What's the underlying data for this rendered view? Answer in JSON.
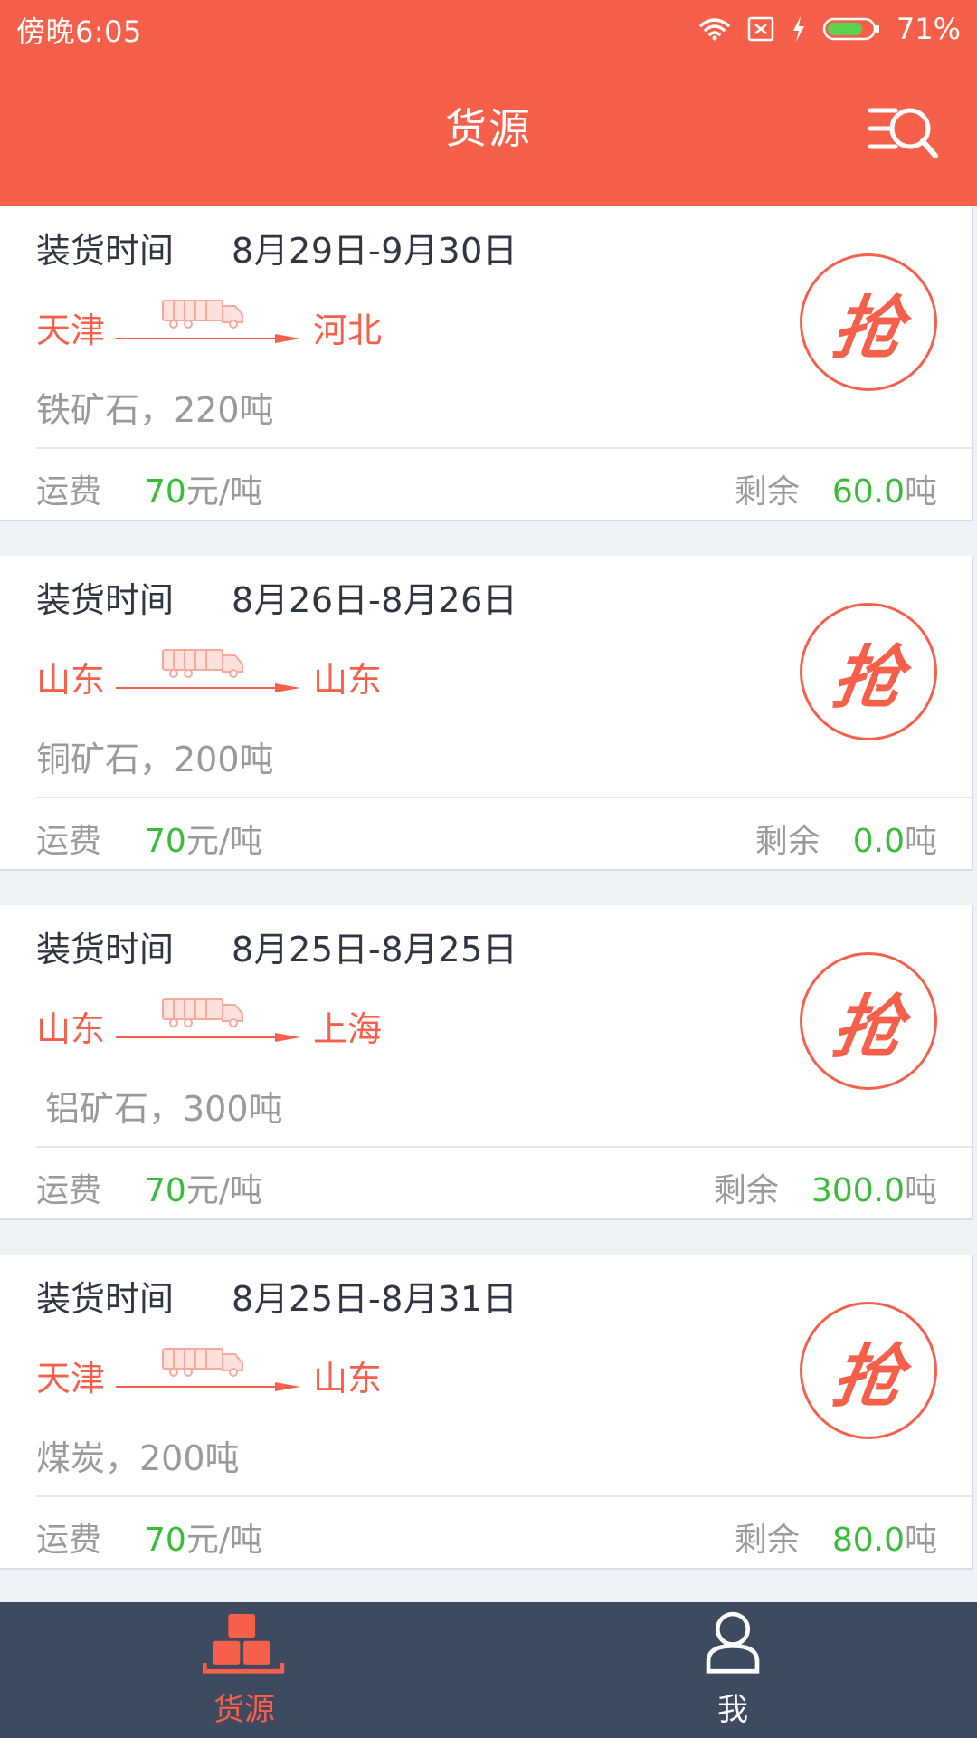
{
  "status_bar": {
    "time": "傍晚6:05",
    "battery_percent": "71%"
  },
  "header": {
    "title": "货源"
  },
  "colors": {
    "primary": "#f6604a",
    "green": "#3bbb3a",
    "nav_bg": "#3d4a5f"
  },
  "orders": [
    {
      "time_label": "装货时间",
      "time_value": "8月29日-9月30日",
      "origin": "天津",
      "destination": "河北",
      "cargo": "铁矿石，220吨",
      "fee_label": "运费",
      "fee_num": "70",
      "fee_unit": "元/吨",
      "remain_label": "剩余",
      "remain_num": "60.0",
      "remain_unit": "吨",
      "grab": "抢"
    },
    {
      "time_label": "装货时间",
      "time_value": "8月26日-8月26日",
      "origin": "山东",
      "destination": "山东",
      "cargo": "铜矿石，200吨",
      "fee_label": "运费",
      "fee_num": "70",
      "fee_unit": "元/吨",
      "remain_label": "剩余",
      "remain_num": "0.0",
      "remain_unit": "吨",
      "grab": "抢"
    },
    {
      "time_label": "装货时间",
      "time_value": "8月25日-8月25日",
      "origin": "山东",
      "destination": "上海",
      "cargo": "铝矿石，300吨",
      "fee_label": "运费",
      "fee_num": "70",
      "fee_unit": "元/吨",
      "remain_label": "剩余",
      "remain_num": "300.0",
      "remain_unit": "吨",
      "grab": "抢"
    },
    {
      "time_label": "装货时间",
      "time_value": "8月25日-8月31日",
      "origin": "天津",
      "destination": "山东",
      "cargo": "煤炭，200吨",
      "fee_label": "运费",
      "fee_num": "70",
      "fee_unit": "元/吨",
      "remain_label": "剩余",
      "remain_num": "80.0",
      "remain_unit": "吨",
      "grab": "抢"
    }
  ],
  "bottom_nav": {
    "items": [
      {
        "label": "货源",
        "icon": "boxes-icon",
        "active": true
      },
      {
        "label": "我",
        "icon": "user-icon",
        "active": false
      }
    ]
  }
}
